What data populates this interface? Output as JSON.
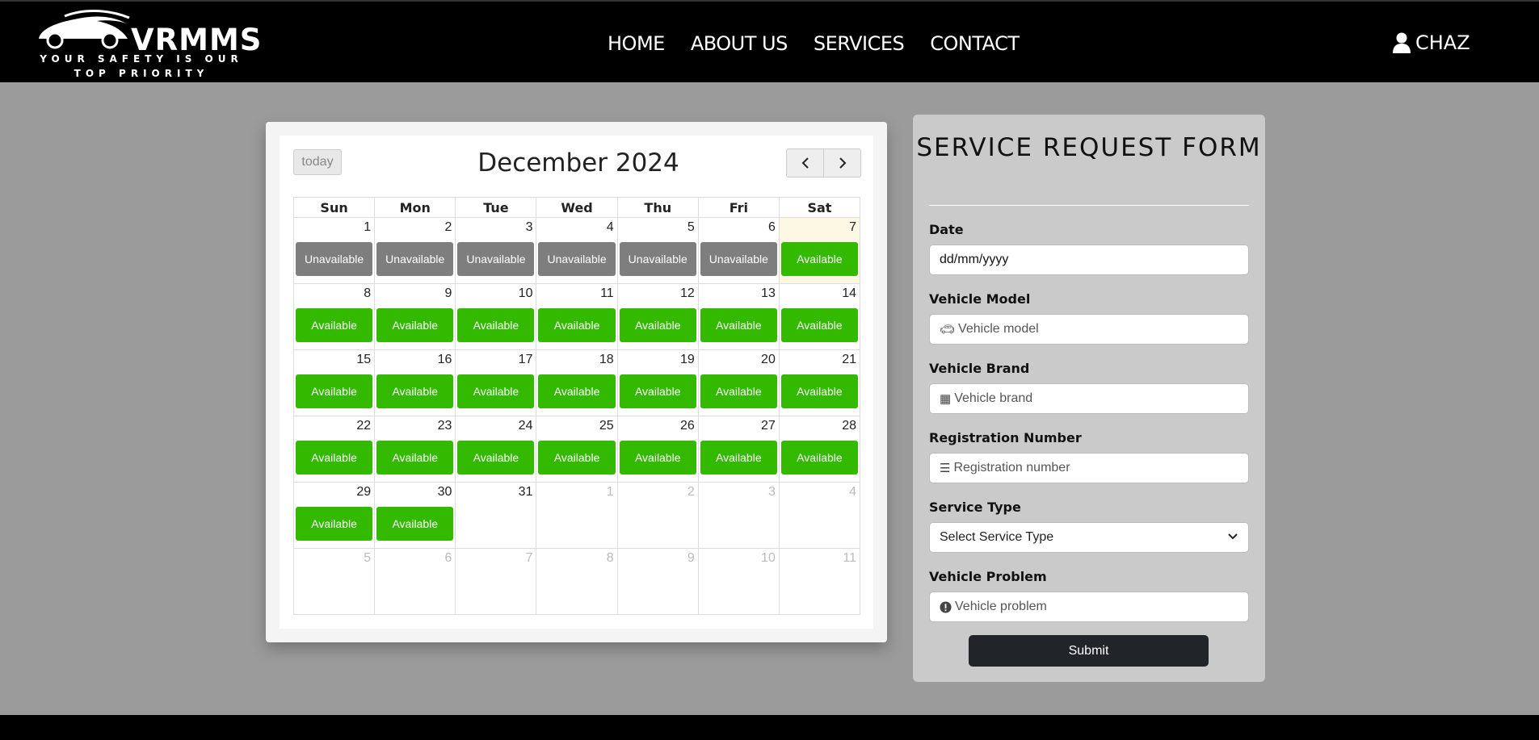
{
  "brand": {
    "name": "VRMMS",
    "tagline_line1": "YOUR SAFETY IS OUR",
    "tagline_line2": "TOP PRIORITY"
  },
  "nav": {
    "items": [
      "HOME",
      "ABOUT US",
      "SERVICES",
      "CONTACT"
    ]
  },
  "user": {
    "name": "CHAZ",
    "icon": "user-icon"
  },
  "calendar": {
    "today_label": "today",
    "title": "December 2024",
    "prev_icon": "chevron-left-icon",
    "next_icon": "chevron-right-icon",
    "weekdays": [
      "Sun",
      "Mon",
      "Tue",
      "Wed",
      "Thu",
      "Fri",
      "Sat"
    ],
    "weeks": [
      [
        {
          "d": "1",
          "s": "Unavailable"
        },
        {
          "d": "2",
          "s": "Unavailable"
        },
        {
          "d": "3",
          "s": "Unavailable"
        },
        {
          "d": "4",
          "s": "Unavailable"
        },
        {
          "d": "5",
          "s": "Unavailable"
        },
        {
          "d": "6",
          "s": "Unavailable"
        },
        {
          "d": "7",
          "s": "Available",
          "today": true
        }
      ],
      [
        {
          "d": "8",
          "s": "Available"
        },
        {
          "d": "9",
          "s": "Available"
        },
        {
          "d": "10",
          "s": "Available"
        },
        {
          "d": "11",
          "s": "Available"
        },
        {
          "d": "12",
          "s": "Available"
        },
        {
          "d": "13",
          "s": "Available"
        },
        {
          "d": "14",
          "s": "Available"
        }
      ],
      [
        {
          "d": "15",
          "s": "Available"
        },
        {
          "d": "16",
          "s": "Available"
        },
        {
          "d": "17",
          "s": "Available"
        },
        {
          "d": "18",
          "s": "Available"
        },
        {
          "d": "19",
          "s": "Available"
        },
        {
          "d": "20",
          "s": "Available"
        },
        {
          "d": "21",
          "s": "Available"
        }
      ],
      [
        {
          "d": "22",
          "s": "Available"
        },
        {
          "d": "23",
          "s": "Available"
        },
        {
          "d": "24",
          "s": "Available"
        },
        {
          "d": "25",
          "s": "Available"
        },
        {
          "d": "26",
          "s": "Available"
        },
        {
          "d": "27",
          "s": "Available"
        },
        {
          "d": "28",
          "s": "Available"
        }
      ],
      [
        {
          "d": "29",
          "s": "Available"
        },
        {
          "d": "30",
          "s": "Available"
        },
        {
          "d": "31",
          "s": ""
        },
        {
          "d": "1",
          "s": "",
          "other": true
        },
        {
          "d": "2",
          "s": "",
          "other": true
        },
        {
          "d": "3",
          "s": "",
          "other": true
        },
        {
          "d": "4",
          "s": "",
          "other": true
        }
      ],
      [
        {
          "d": "5",
          "s": "",
          "other": true
        },
        {
          "d": "6",
          "s": "",
          "other": true
        },
        {
          "d": "7",
          "s": "",
          "other": true
        },
        {
          "d": "8",
          "s": "",
          "other": true
        },
        {
          "d": "9",
          "s": "",
          "other": true
        },
        {
          "d": "10",
          "s": "",
          "other": true
        },
        {
          "d": "11",
          "s": "",
          "other": true
        }
      ]
    ],
    "colors": {
      "available": "#32b900",
      "unavailable": "#7e7e7e",
      "today_bg": "#fcf8e3"
    }
  },
  "form": {
    "title": "SERVICE REQUEST FORM",
    "date_label": "Date",
    "date_value": "dd/mm/yyyy",
    "model_label": "Vehicle Model",
    "model_placeholder": "Vehicle model",
    "brand_label": "Vehicle Brand",
    "brand_placeholder": "Vehicle brand",
    "reg_label": "Registration Number",
    "reg_placeholder": "Registration number",
    "service_label": "Service Type",
    "service_value": "Select Service Type",
    "problem_label": "Vehicle Problem",
    "problem_placeholder": "Vehicle problem",
    "submit_label": "Submit"
  }
}
